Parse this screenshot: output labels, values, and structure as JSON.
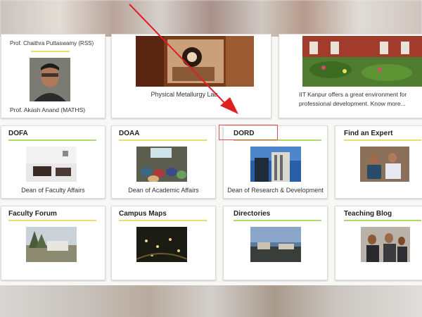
{
  "top_row": {
    "card1": {
      "caption_top": "Prof. Chaithra Puttaswamy (RSS)",
      "caption_bottom": "Prof. Akash Anand (MATHS)"
    },
    "card2": {
      "caption": "Physical Metallurgy Lab"
    },
    "card3": {
      "caption_line1": "IIT Kanpur offers a great environment for",
      "caption_line2": "professional development. Know more..."
    }
  },
  "cards": [
    {
      "title": "DOFA",
      "caption": "Dean of Faculty Affairs"
    },
    {
      "title": "DOAA",
      "caption": "Dean of Academic Affairs"
    },
    {
      "title": "DORD",
      "caption": "Dean of Research & Development"
    },
    {
      "title": "Find an Expert",
      "caption": ""
    },
    {
      "title": "Faculty Forum",
      "caption": ""
    },
    {
      "title": "Campus Maps",
      "caption": ""
    },
    {
      "title": "Directories",
      "caption": ""
    },
    {
      "title": "Teaching Blog",
      "caption": ""
    }
  ],
  "colors": {
    "accent_green": "#a9d86b",
    "accent_yellow": "#f1d86a",
    "annotation_red": "#e02020"
  }
}
